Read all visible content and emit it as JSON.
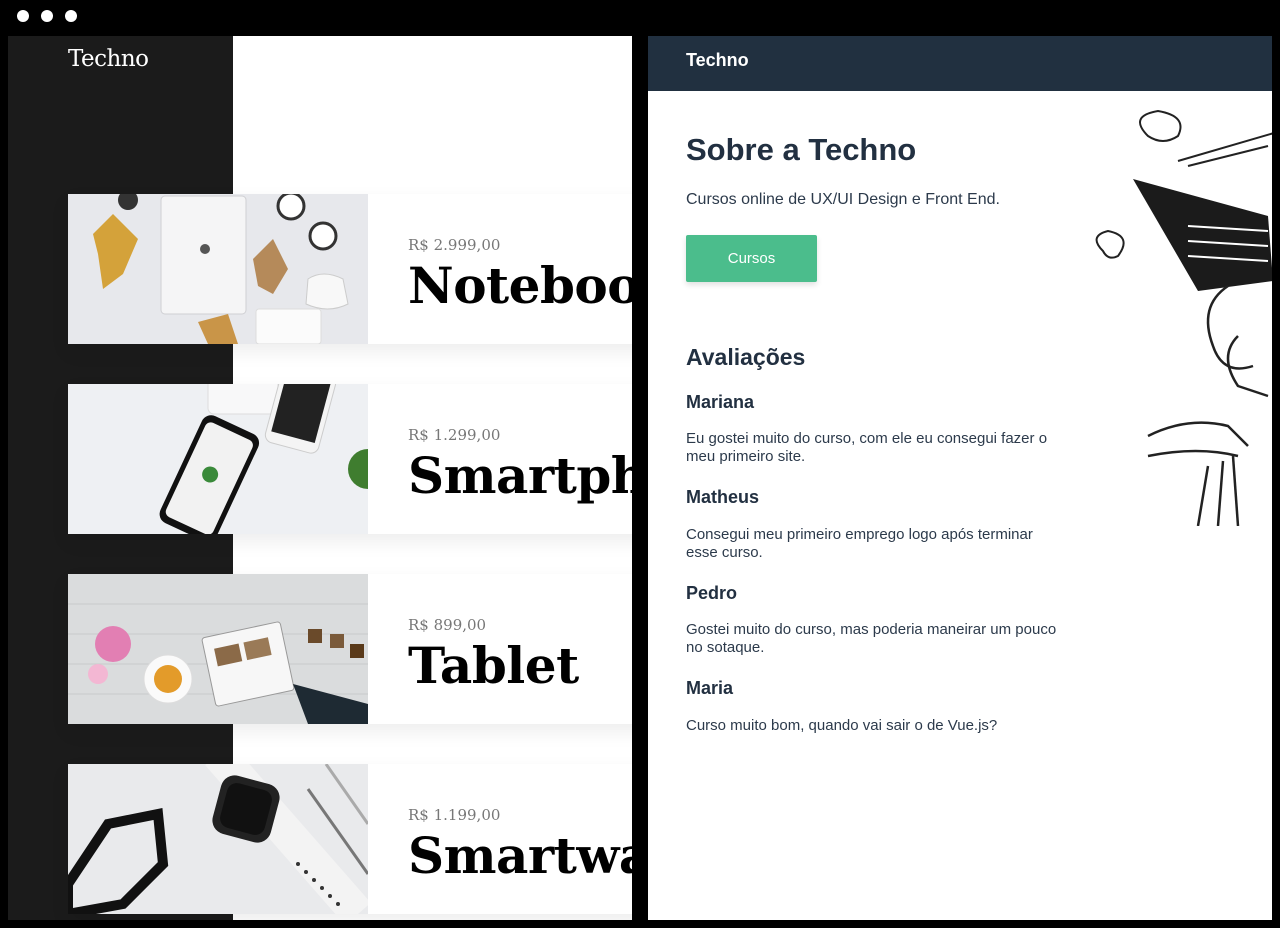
{
  "store": {
    "logo": "Techno",
    "products": [
      {
        "price": "R$ 2.999,00",
        "name": "Notebook",
        "image": "notebook-flatlay"
      },
      {
        "price": "R$ 1.299,00",
        "name": "Smartphone",
        "image": "smartphone-desk"
      },
      {
        "price": "R$ 899,00",
        "name": "Tablet",
        "image": "tablet-table"
      },
      {
        "price": "R$ 1.199,00",
        "name": "Smartwatch",
        "image": "smartwatch-desk"
      }
    ]
  },
  "about": {
    "header_brand": "Techno",
    "title": "Sobre a Techno",
    "description": "Cursos online de UX/UI Design e Front End.",
    "button_label": "Cursos",
    "reviews_title": "Avaliações",
    "reviews": [
      {
        "name": "Mariana",
        "text": "Eu gostei muito do curso, com ele eu consegui fazer o meu primeiro site."
      },
      {
        "name": "Matheus",
        "text": "Consegui meu primeiro emprego logo após terminar esse curso."
      },
      {
        "name": "Pedro",
        "text": "Gostei muito do curso, mas poderia maneirar um pouco no sotaque."
      },
      {
        "name": "Maria",
        "text": "Curso muito bom, quando vai sair o de Vue.js?"
      }
    ]
  },
  "colors": {
    "sidebar": "#1b1b1b",
    "topbar": "#213040",
    "button": "#4bbd8c",
    "heading": "#223041"
  }
}
